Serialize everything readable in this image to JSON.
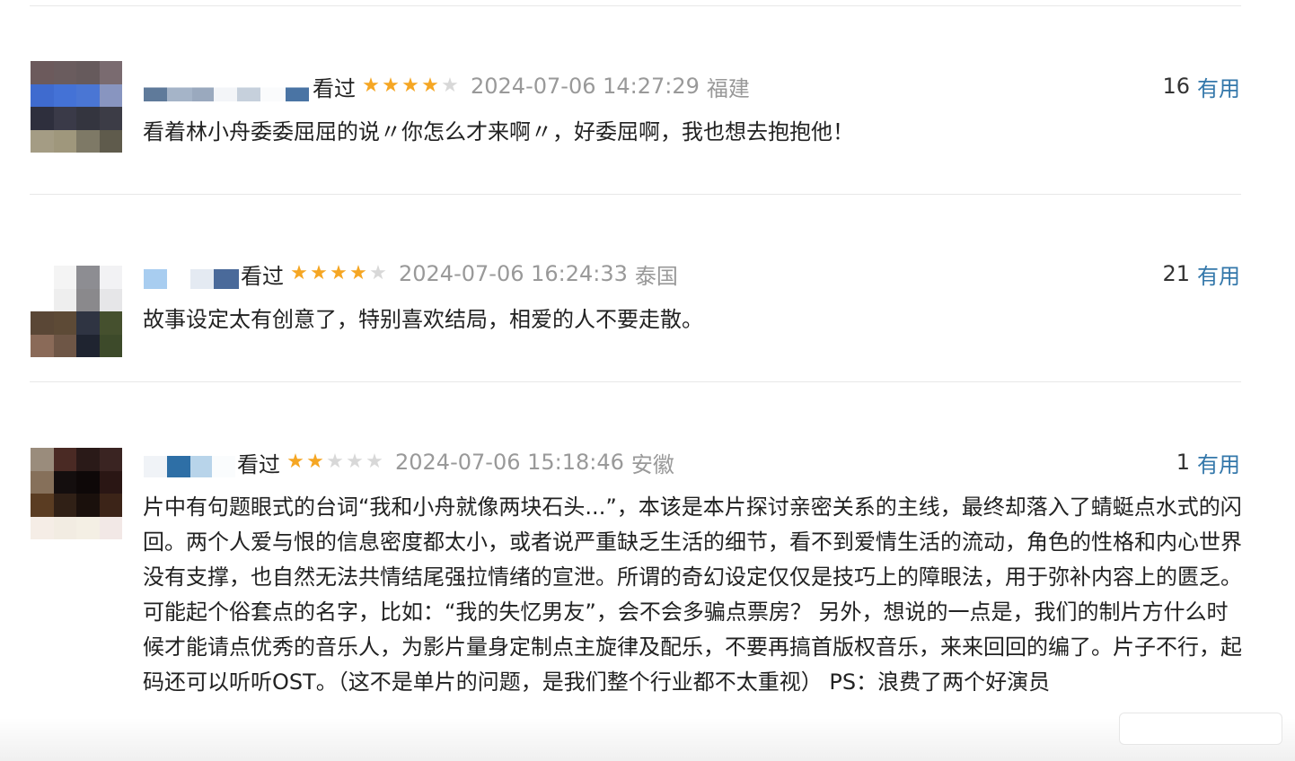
{
  "comments": [
    {
      "status": "看过",
      "rating": 4,
      "time": "2024-07-06 14:27:29",
      "location": "福建",
      "votes": "16",
      "useful_label": "有用",
      "content": "看着林小舟委委屈屈的说〃你怎么才来啊〃，好委屈啊，我也想去抱抱他！"
    },
    {
      "status": "看过",
      "rating": 4,
      "time": "2024-07-06 16:24:33",
      "location": "泰国",
      "votes": "21",
      "useful_label": "有用",
      "content": "故事设定太有创意了，特别喜欢结局，相爱的人不要走散。"
    },
    {
      "status": "看过",
      "rating": 2,
      "time": "2024-07-06 15:18:46",
      "location": "安徽",
      "votes": "1",
      "useful_label": "有用",
      "content": "片中有句题眼式的台词“我和小舟就像两块石头...”，本该是本片探讨亲密关系的主线，最终却落入了蜻蜓点水式的闪回。两个人爱与恨的信息密度都太小，或者说严重缺乏生活的细节，看不到爱情生活的流动，角色的性格和内心世界没有支撑，也自然无法共情结尾强拉情绪的宣泄。所谓的奇幻设定仅仅是技巧上的障眼法，用于弥补内容上的匮乏。可能起个俗套点的名字，比如：“我的失忆男友”，会不会多骗点票房？ 另外，想说的一点是，我们的制片方什么时候才能请点优秀的音乐人，为影片量身定制点主旋律及配乐，不要再搞首版权音乐，来来回回的编了。片子不行，起码还可以听听OST。（这不是单片的问题，是我们整个行业都不太重视） PS：浪费了两个好演员"
    }
  ],
  "colors": {
    "star_on": "#f5a623",
    "star_off": "#d8d8d8",
    "useful_link": "#3377aa",
    "meta_gray": "#999999"
  }
}
